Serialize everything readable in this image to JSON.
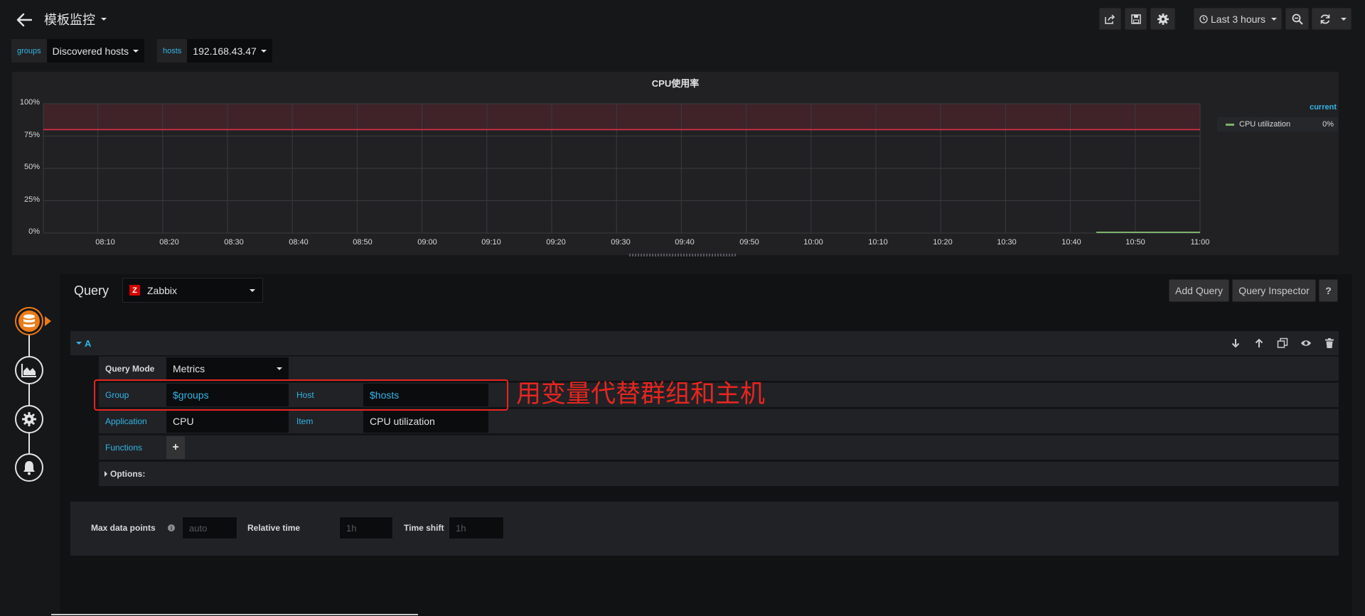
{
  "header": {
    "title": "模板监控",
    "time_range": "Last 3 hours"
  },
  "variables": [
    {
      "label": "groups",
      "value": "Discovered hosts"
    },
    {
      "label": "hosts",
      "value": "192.168.43.47"
    }
  ],
  "panel": {
    "title": "CPU使用率",
    "legend": {
      "header": "current",
      "series_name": "CPU utilization",
      "series_value": "0%"
    }
  },
  "chart_data": {
    "type": "line",
    "title": "CPU使用率",
    "ylabel": "",
    "xlabel": "",
    "ylim": [
      0,
      100
    ],
    "y_ticks": [
      "0%",
      "25%",
      "50%",
      "75%",
      "100%"
    ],
    "x_ticks": [
      "08:10",
      "08:20",
      "08:30",
      "08:40",
      "08:50",
      "09:00",
      "09:10",
      "09:20",
      "09:30",
      "09:40",
      "09:50",
      "10:00",
      "10:10",
      "10:20",
      "10:30",
      "10:40",
      "10:50",
      "11:00"
    ],
    "threshold": {
      "value": 80,
      "color": "#e02f44"
    },
    "series": [
      {
        "name": "CPU utilization",
        "color": "#7eb26d",
        "x": [
          "10:44",
          "11:00"
        ],
        "y": [
          0,
          0
        ]
      }
    ],
    "legend_position": "right",
    "grid": true
  },
  "query": {
    "label": "Query",
    "datasource": "Zabbix",
    "add_query": "Add Query",
    "inspector": "Query Inspector",
    "help": "?",
    "ref_id": "A",
    "mode_label": "Query Mode",
    "mode_value": "Metrics",
    "group_label": "Group",
    "group_value": "$groups",
    "host_label": "Host",
    "host_value": "$hosts",
    "app_label": "Application",
    "app_value": "CPU",
    "item_label": "Item",
    "item_value": "CPU utilization",
    "functions_label": "Functions",
    "add_function": "+",
    "options_label": "Options:"
  },
  "annotation": {
    "text": "用变量代替群组和主机",
    "color": "#e8251f"
  },
  "query_options": {
    "max_points_label": "Max data points",
    "max_points_placeholder": "auto",
    "relative_label": "Relative time",
    "relative_placeholder": "1h",
    "shift_label": "Time shift",
    "shift_placeholder": "1h"
  }
}
